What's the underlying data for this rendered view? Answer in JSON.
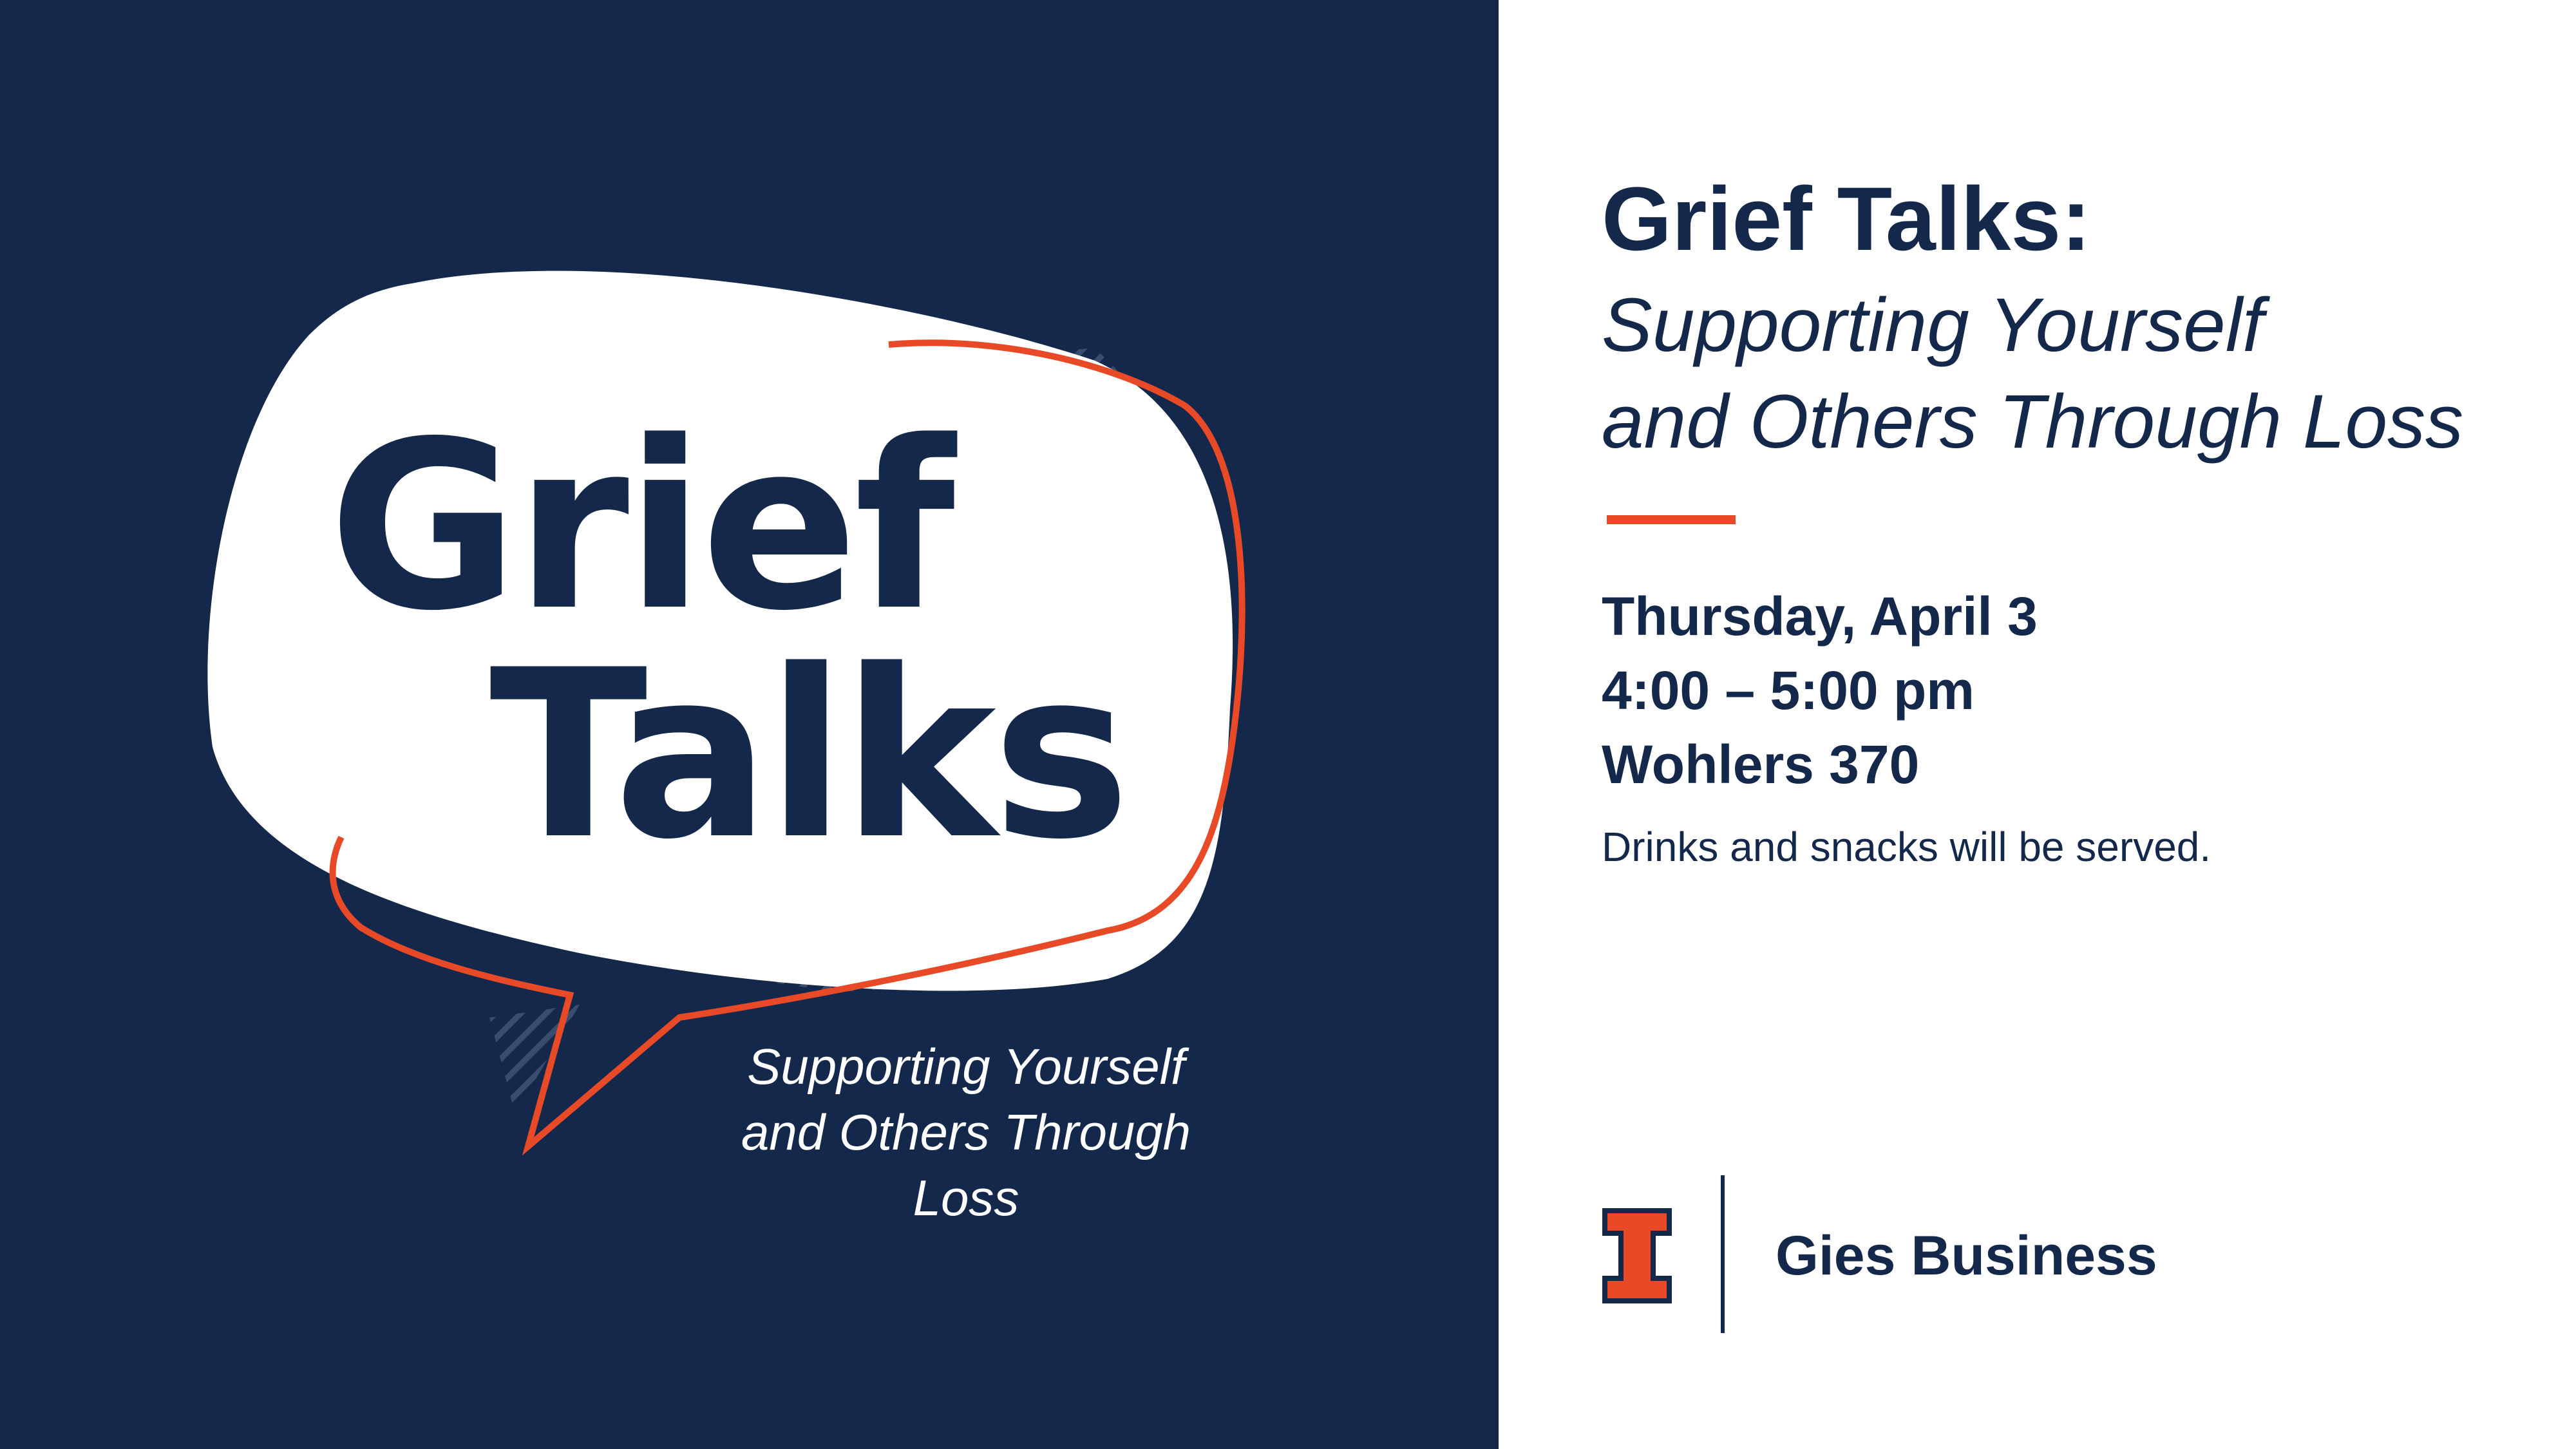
{
  "left": {
    "bubble_title_line1": "Grief",
    "bubble_title_line2": "Talks",
    "subtitle_line1": "Supporting Yourself",
    "subtitle_line2": "and Others Through Loss"
  },
  "right": {
    "title": "Grief Talks:",
    "subtitle_line1": "Supporting Yourself",
    "subtitle_line2": "and Others Through Loss",
    "date": "Thursday, April 3",
    "time": "4:00 – 5:00 pm",
    "location": "Wohlers 370",
    "note": "Drinks and snacks will be served."
  },
  "brand": {
    "logo_icon": "block-i-icon",
    "name": "Gies Business"
  },
  "colors": {
    "navy": "#14284b",
    "orange": "#e84a27",
    "white": "#ffffff"
  }
}
